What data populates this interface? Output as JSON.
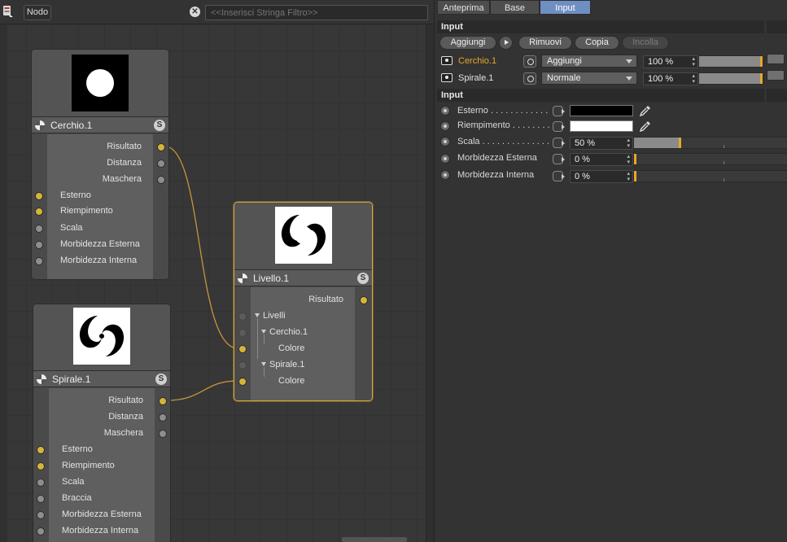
{
  "editor": {
    "toolbar": {
      "node_button": "Nodo",
      "filter_placeholder": "<<Inserisci Stringa Filtro>>"
    },
    "nodes": [
      {
        "title": "Cerchio.1",
        "badge": "S",
        "outputs": [
          "Risultato",
          "Distanza",
          "Maschera"
        ],
        "inputs": [
          "Esterno",
          "Riempimento",
          "Scala",
          "Morbidezza Esterna",
          "Morbidezza Interna"
        ]
      },
      {
        "title": "Livello.1",
        "badge": "S",
        "outputs": [
          "Risultato"
        ],
        "tree": {
          "root": "Livelli",
          "layers": [
            {
              "name": "Cerchio.1",
              "child": "Colore"
            },
            {
              "name": "Spirale.1",
              "child": "Colore"
            }
          ]
        }
      },
      {
        "title": "Spirale.1",
        "badge": "S",
        "outputs": [
          "Risultato",
          "Distanza",
          "Maschera"
        ],
        "inputs": [
          "Esterno",
          "Riempimento",
          "Scala",
          "Braccia",
          "Morbidezza Esterna",
          "Morbidezza Interna"
        ]
      }
    ]
  },
  "panel": {
    "tabs": [
      {
        "label": "Anteprima",
        "active": false
      },
      {
        "label": "Base",
        "active": false
      },
      {
        "label": "Input",
        "active": true
      }
    ],
    "layers_section": {
      "title": "Input",
      "buttons": {
        "add": "Aggiungi",
        "remove": "Rimuovi",
        "copy": "Copia",
        "paste": "Incolla"
      },
      "layers": [
        {
          "name": "Cerchio.1",
          "blend": "Aggiungi",
          "opacity": "100 %",
          "highlighted": true
        },
        {
          "name": "Spirale.1",
          "blend": "Normale",
          "opacity": "100 %",
          "highlighted": false
        }
      ]
    },
    "input_section": {
      "title": "Input",
      "rows": [
        {
          "label": "Esterno . . . . . . . . . . . .",
          "type": "color",
          "color": "#000000"
        },
        {
          "label": "Riempimento . . . . . . . .",
          "type": "color",
          "color": "#ffffff"
        },
        {
          "label": "Scala . . . . . . . . . . . . . . .",
          "type": "slider",
          "value": "50 %",
          "fraction": 0.5
        },
        {
          "label": "Morbidezza Esterna",
          "type": "slider",
          "value": "0 %",
          "fraction": 0.0
        },
        {
          "label": "Morbidezza Interna",
          "type": "slider",
          "value": "0 %",
          "fraction": 0.0
        }
      ]
    },
    "colors": {
      "accent_tab": "#6f8fc2",
      "highlight_text": "#e8a72b",
      "port_active": "#d4b53a",
      "wire": "#c8963a"
    }
  }
}
